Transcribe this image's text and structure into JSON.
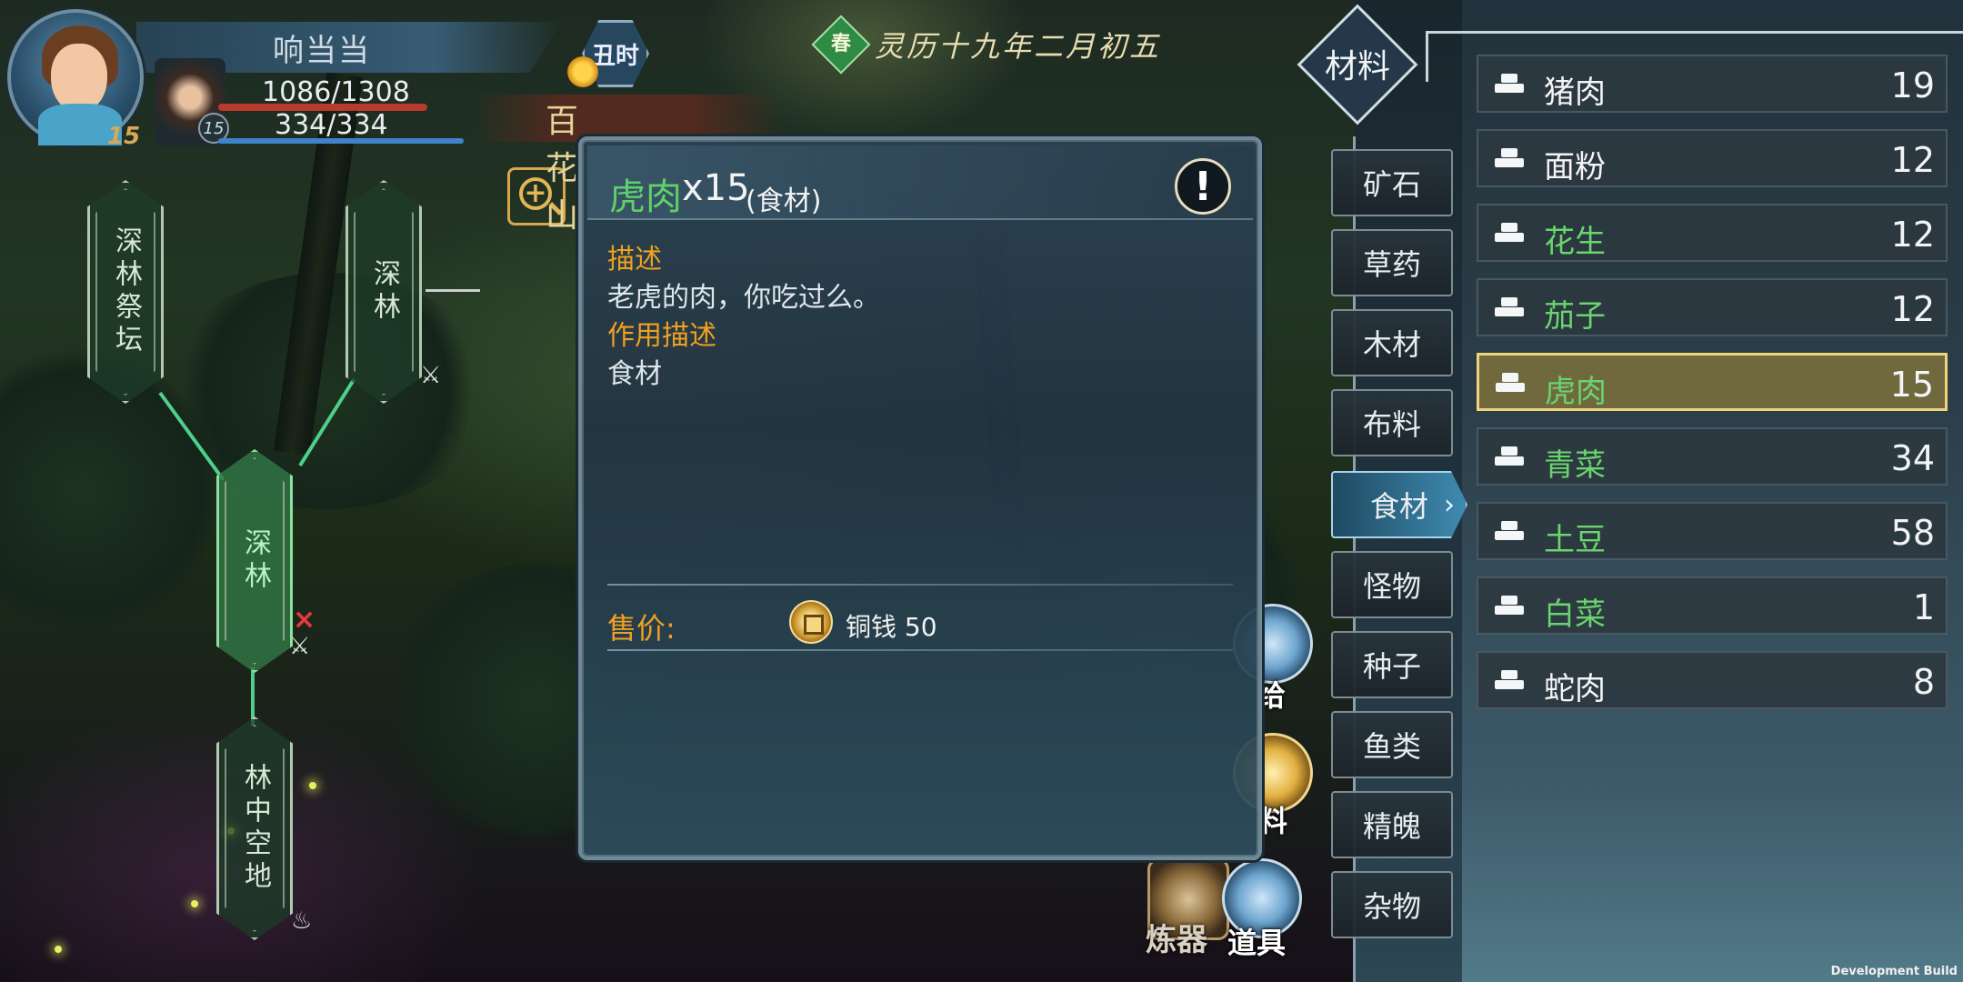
{
  "hud": {
    "player_name": "响当当",
    "player_level": "15",
    "hp": "1086/1308",
    "mp": "334/334",
    "companion_level": "15",
    "time_of_day": "丑时",
    "location": "百花山"
  },
  "date": {
    "season": "春",
    "text": "灵历十九年二月初五"
  },
  "map": {
    "nodes": [
      "深林祭坛",
      "深林",
      "深林",
      "林中空地"
    ],
    "enemy_mark": "×",
    "battle_mark": "⚔"
  },
  "side_buttons": {
    "give": "给",
    "materials": "料",
    "items": "道具",
    "refine": "炼器"
  },
  "detail": {
    "name": "虎肉",
    "qty": "x15",
    "category": "(食材)",
    "info_icon": "!",
    "desc_title": "描述",
    "desc_text": "老虎的肉，你吃过么。",
    "effect_title": "作用描述",
    "effect_text": "食材",
    "price_label": "售价:",
    "price_text": "铜钱 50"
  },
  "inventory": {
    "category": "材料",
    "tabs": [
      "矿石",
      "草药",
      "木材",
      "布料",
      "食材",
      "怪物",
      "种子",
      "鱼类",
      "精魄",
      "杂物"
    ],
    "active_tab": "食材",
    "items": [
      {
        "name": "猪肉",
        "count": "19",
        "green": false
      },
      {
        "name": "面粉",
        "count": "12",
        "green": false
      },
      {
        "name": "花生",
        "count": "12",
        "green": true
      },
      {
        "name": "茄子",
        "count": "12",
        "green": true
      },
      {
        "name": "虎肉",
        "count": "15",
        "green": true,
        "selected": true
      },
      {
        "name": "青菜",
        "count": "34",
        "green": true
      },
      {
        "name": "土豆",
        "count": "58",
        "green": true
      },
      {
        "name": "白菜",
        "count": "1",
        "green": true
      },
      {
        "name": "蛇肉",
        "count": "8",
        "green": false
      }
    ]
  },
  "footer": {
    "build": "Development Build"
  },
  "colors": {
    "rarity_green": "#6ad46e",
    "label_orange": "#f0a020",
    "selected_gold": "#f0d47a"
  }
}
